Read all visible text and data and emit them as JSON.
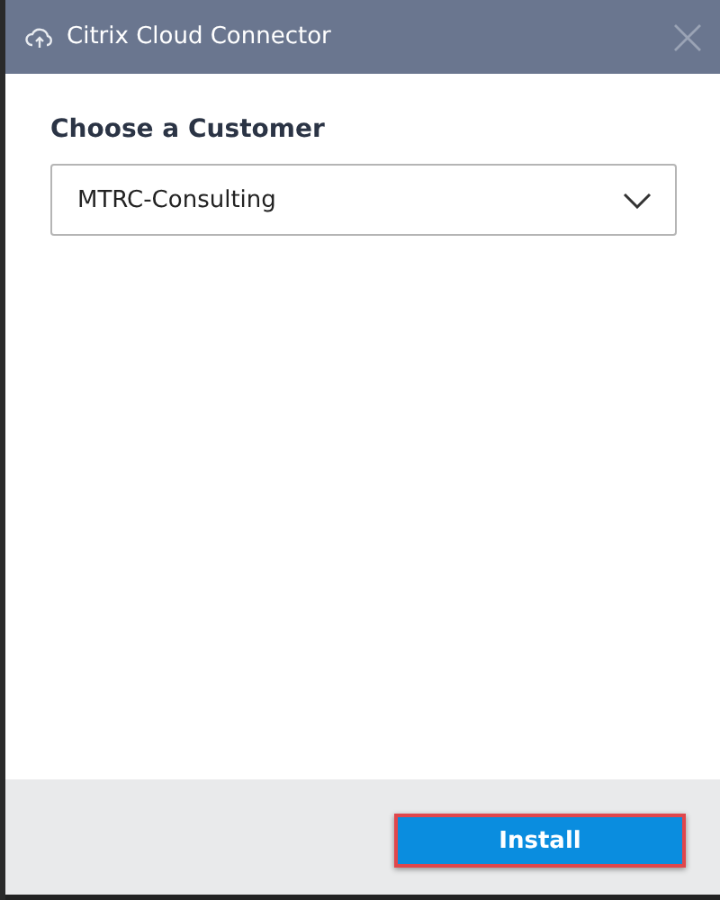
{
  "window": {
    "title": "Citrix Cloud Connector"
  },
  "label": "Choose a Customer",
  "customer_select": {
    "value": "MTRC-Consulting"
  },
  "buttons": [
    {
      "label": "Install",
      "highlighted": true
    }
  ]
}
